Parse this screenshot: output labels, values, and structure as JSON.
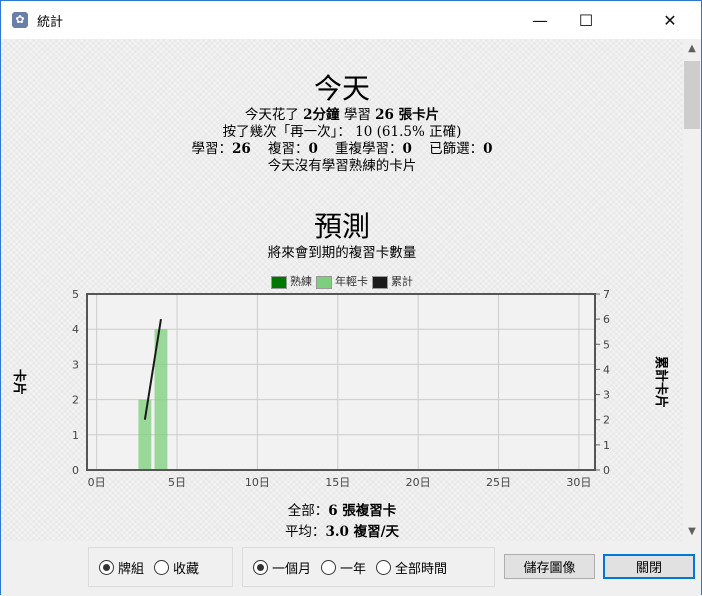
{
  "window": {
    "title": "統計",
    "icon": "app-icon",
    "minimize": "—",
    "maximize": "☐",
    "close": "✕"
  },
  "today": {
    "heading": "今天",
    "line1_pre": "今天花了 ",
    "line1_time": "2分鐘",
    "line1_mid": " 學習 ",
    "line1_count": "26 張卡片",
    "line2": "按了幾次「再一次」： 10 (61.5% 正確)",
    "line3_learn_label": "學習：",
    "line3_learn": "26",
    "line3_review_label": "複習：",
    "line3_review": "0",
    "line3_relearn_label": "重複學習：",
    "line3_relearn": "0",
    "line3_filtered_label": "已篩選：",
    "line3_filtered": "0",
    "line4": "今天沒有學習熟練的卡片"
  },
  "forecast": {
    "heading": "預測",
    "subtitle": "將來會到期的複習卡數量",
    "total_label": "全部：",
    "total_value": "6 張複習卡",
    "avg_label": "平均：",
    "avg_value": "3.0 複習/天"
  },
  "chart_data": {
    "type": "bar",
    "title": "",
    "xlabel": "",
    "ylabel": "卡片",
    "y2label": "累計卡片",
    "legend": [
      {
        "name": "熟練",
        "color": "#007700"
      },
      {
        "name": "年輕卡",
        "color": "#7ccf7c"
      },
      {
        "name": "累計",
        "color": "#1a1a1a"
      }
    ],
    "legend_position": "top-center",
    "x": [
      3,
      4
    ],
    "series": [
      {
        "name": "熟練",
        "values": [
          0,
          0
        ]
      },
      {
        "name": "年輕卡",
        "values": [
          2,
          4
        ]
      },
      {
        "name": "累計",
        "type": "line",
        "axis": "right",
        "values": [
          2,
          6
        ]
      }
    ],
    "xlim": [
      -0.6,
      31
    ],
    "ylim": [
      0,
      5
    ],
    "y2lim": [
      0,
      7
    ],
    "xticks": [
      0,
      5,
      10,
      15,
      20,
      25,
      30
    ],
    "xtick_labels": [
      "0日",
      "5日",
      "10日",
      "15日",
      "20日",
      "25日",
      "30日"
    ],
    "yticks": [
      0,
      1,
      2,
      3,
      4,
      5
    ],
    "y2ticks": [
      0,
      1,
      2,
      3,
      4,
      5,
      6,
      7
    ],
    "grid": true
  },
  "bottom": {
    "deck": "牌組",
    "collection": "收藏",
    "month": "一個月",
    "year": "一年",
    "all": "全部時間",
    "save": "儲存圖像",
    "close": "關閉"
  }
}
